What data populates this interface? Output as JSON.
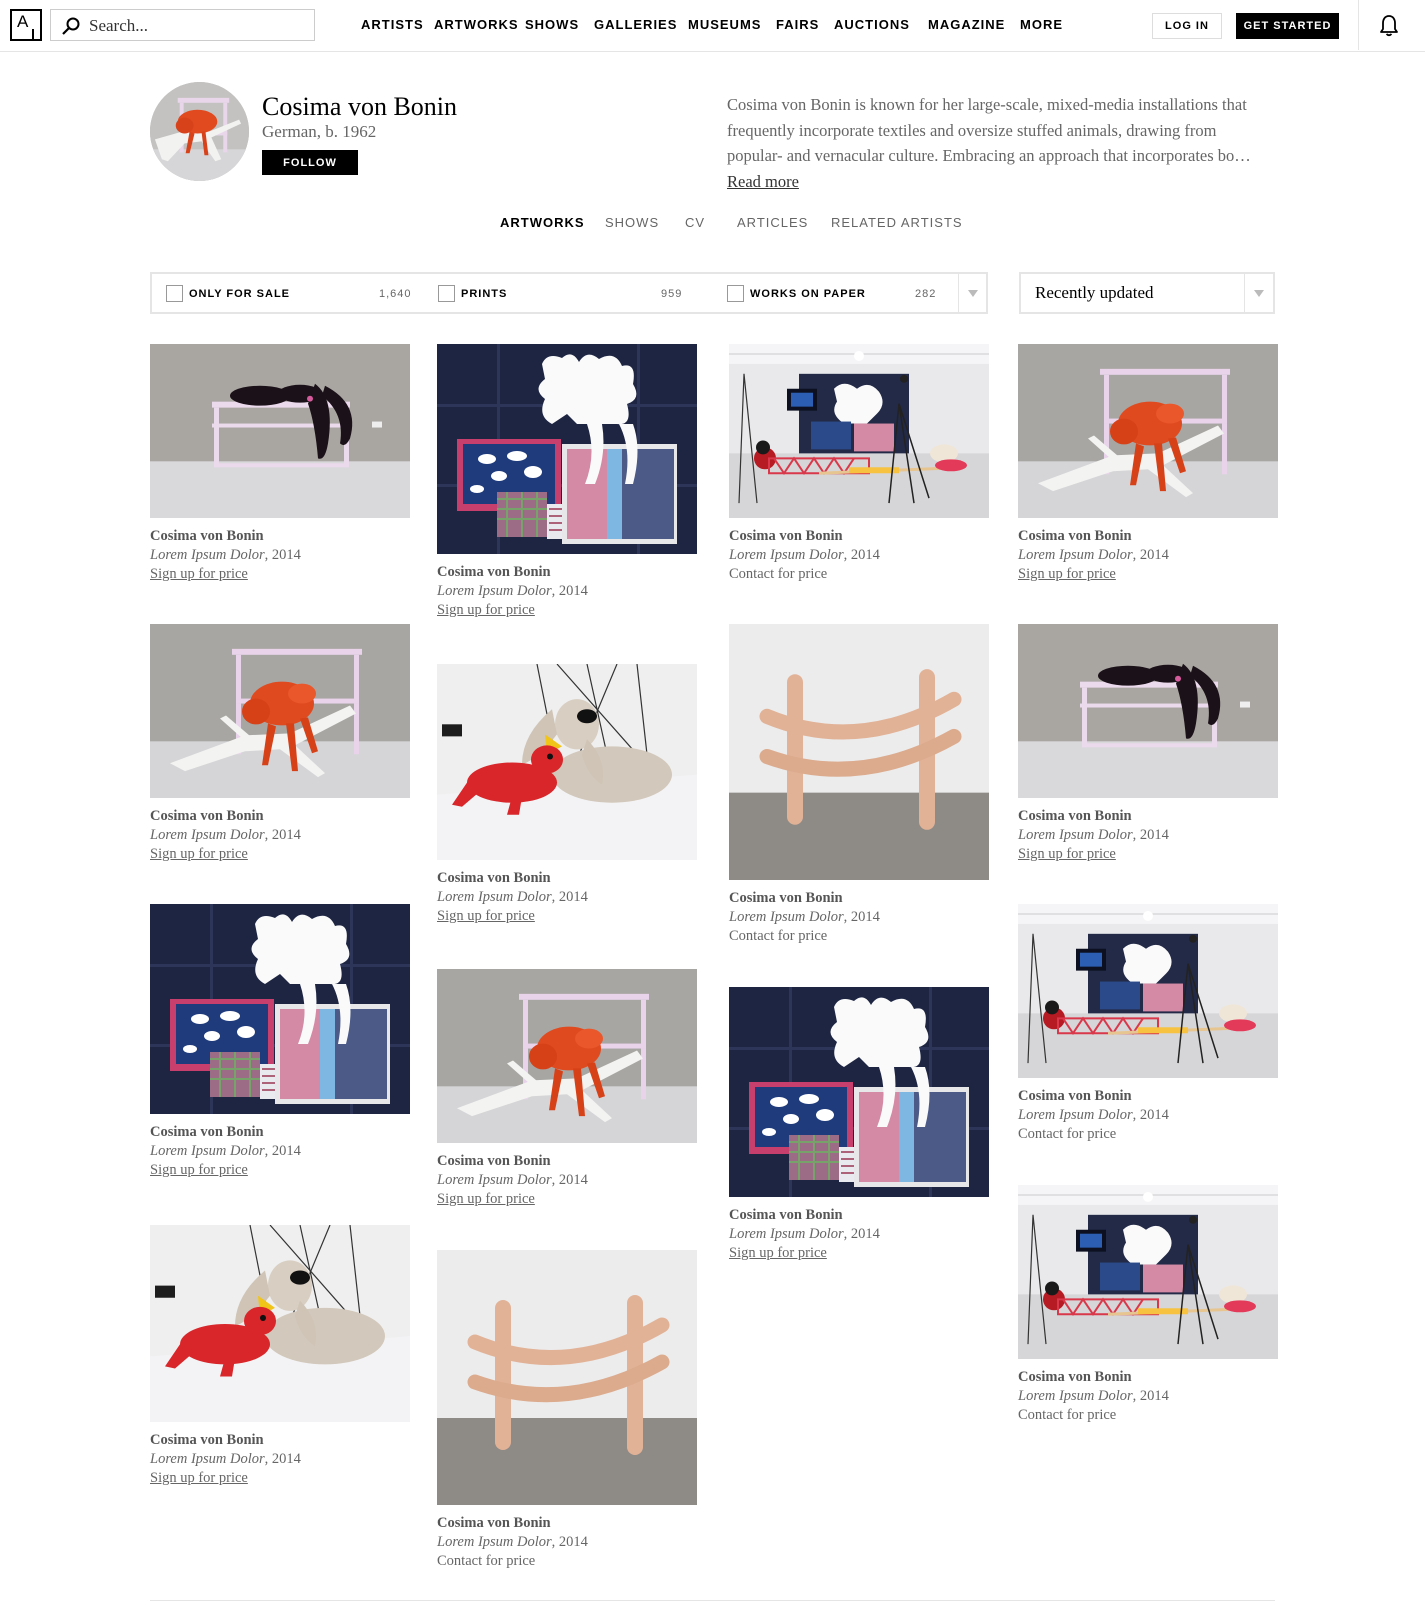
{
  "nav": {
    "logo_letter": "A",
    "search_placeholder": "Search...",
    "links": [
      "ARTISTS",
      "ARTWORKS",
      "SHOWS",
      "GALLERIES",
      "MUSEUMS",
      "FAIRS",
      "AUCTIONS",
      "MAGAZINE",
      "MORE"
    ],
    "login_label": "LOG IN",
    "signup_label": "GET STARTED"
  },
  "artist": {
    "name": "Cosima von Bonin",
    "meta": "German, b. 1962",
    "follow_label": "FOLLOW",
    "bio": "Cosima von Bonin is known for her large-scale, mixed-media installations that frequently incorporate textiles and oversize stuffed animals, drawing from popular- and vernacular culture. Embracing an approach that incorporates bo…",
    "read_more": "Read more"
  },
  "tabs": [
    "ARTWORKS",
    "SHOWS",
    "CV",
    "ARTICLES",
    "RELATED ARTISTS"
  ],
  "active_tab": "ARTWORKS",
  "filters": [
    {
      "label": "ONLY FOR SALE",
      "count": "1,640"
    },
    {
      "label": "PRINTS",
      "count": "959"
    },
    {
      "label": "WORKS ON PAPER",
      "count": "282"
    }
  ],
  "sort": {
    "selected": "Recently updated"
  },
  "artworks": [
    {
      "artist": "Cosima von Bonin",
      "title": "Lorem Ipsum Dolor",
      "year": ", 2014",
      "price": "Sign up for price",
      "price_link": true,
      "image": "black-figure-on-pink-table"
    },
    {
      "artist": "Cosima von Bonin",
      "title": "Lorem Ipsum Dolor",
      "year": ", 2014",
      "price": "Sign up for price",
      "price_link": true,
      "image": "patchwork-textile"
    },
    {
      "artist": "Cosima von Bonin",
      "title": "Lorem Ipsum Dolor",
      "year": ", 2014",
      "price": "Contact for price",
      "price_link": false,
      "image": "gallery-installation"
    },
    {
      "artist": "Cosima von Bonin",
      "title": "Lorem Ipsum Dolor",
      "year": ", 2014",
      "price": "Sign up for price",
      "price_link": true,
      "image": "hermit-crab-sculpture"
    },
    {
      "artist": "Cosima von Bonin",
      "title": "Lorem Ipsum Dolor",
      "year": ", 2014",
      "price": "Sign up for price",
      "price_link": true,
      "image": "hermit-crab-sculpture"
    },
    {
      "artist": "Cosima von Bonin",
      "title": "Lorem Ipsum Dolor",
      "year": ", 2014",
      "price": "Sign up for price",
      "price_link": true,
      "image": "stuffed-dog-and-bunny"
    },
    {
      "artist": "Cosima von Bonin",
      "title": "Lorem Ipsum Dolor",
      "year": ", 2014",
      "price": "Contact for price",
      "price_link": false,
      "image": "pink-tube-fence"
    },
    {
      "artist": "Cosima von Bonin",
      "title": "Lorem Ipsum Dolor",
      "year": ", 2014",
      "price": "Sign up for price",
      "price_link": true,
      "image": "black-figure-on-pink-table"
    },
    {
      "artist": "Cosima von Bonin",
      "title": "Lorem Ipsum Dolor",
      "year": ", 2014",
      "price": "Sign up for price",
      "price_link": true,
      "image": "patchwork-textile"
    },
    {
      "artist": "Cosima von Bonin",
      "title": "Lorem Ipsum Dolor",
      "year": ", 2014",
      "price": "Sign up for price",
      "price_link": true,
      "image": "hermit-crab-sculpture"
    },
    {
      "artist": "Cosima von Bonin",
      "title": "Lorem Ipsum Dolor",
      "year": ", 2014",
      "price": "Sign up for price",
      "price_link": true,
      "image": "patchwork-textile"
    },
    {
      "artist": "Cosima von Bonin",
      "title": "Lorem Ipsum Dolor",
      "year": ", 2014",
      "price": "Contact for price",
      "price_link": false,
      "image": "gallery-installation"
    },
    {
      "artist": "Cosima von Bonin",
      "title": "Lorem Ipsum Dolor",
      "year": ", 2014",
      "price": "Sign up for price",
      "price_link": true,
      "image": "stuffed-dog-and-bunny"
    },
    {
      "artist": "Cosima von Bonin",
      "title": "Lorem Ipsum Dolor",
      "year": ", 2014",
      "price": "Contact for price",
      "price_link": false,
      "image": "pink-tube-fence"
    },
    {
      "artist": "Cosima von Bonin",
      "title": "Lorem Ipsum Dolor",
      "year": ", 2014",
      "price": "Contact for price",
      "price_link": false,
      "image": "gallery-installation"
    }
  ]
}
